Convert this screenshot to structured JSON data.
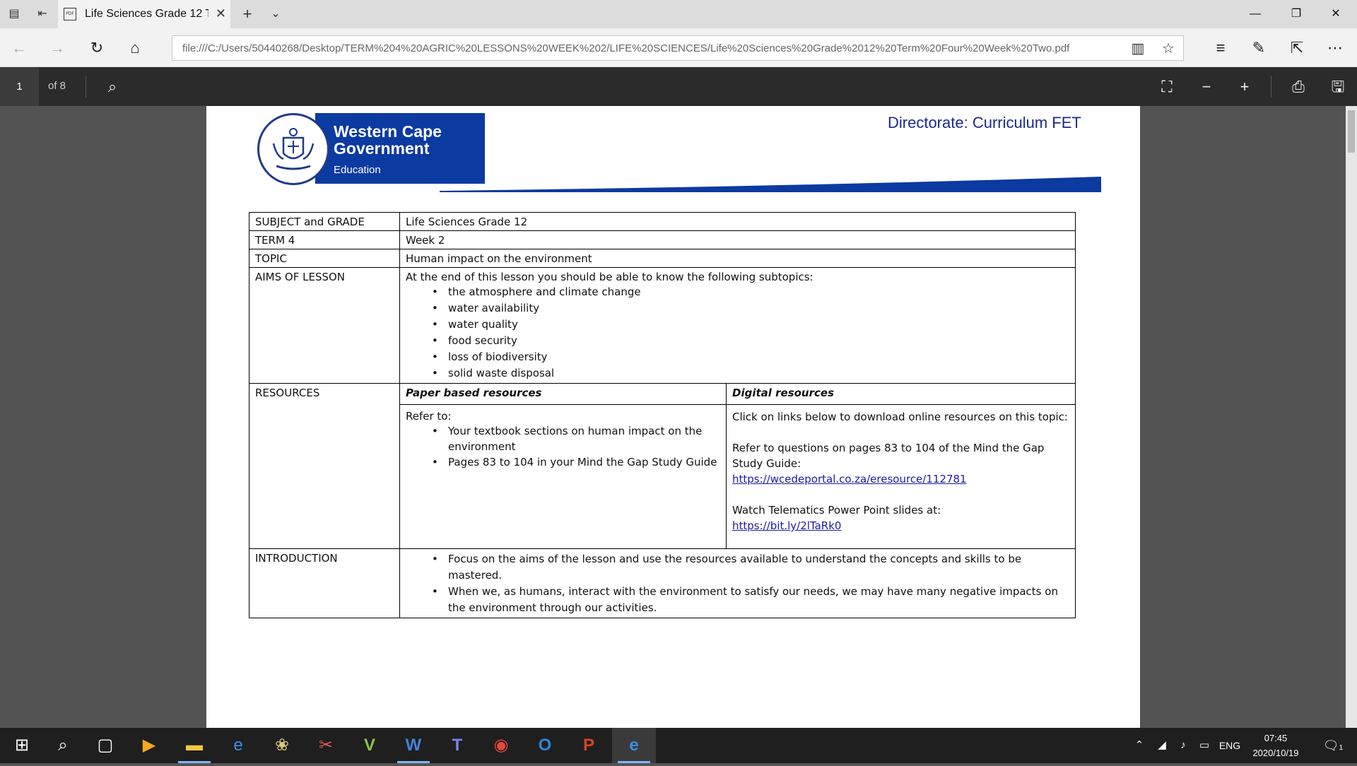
{
  "browser": {
    "tab_title": "Life Sciences Grade 12 T",
    "address": "file:///C:/Users/50440268/Desktop/TERM%204%20AGRIC%20LESSONS%20WEEK%202/LIFE%20SCIENCES/Life%20Sciences%20Grade%2012%20Term%20Four%20Week%20Two.pdf"
  },
  "pdf_toolbar": {
    "current_page": "1",
    "page_total": "of 8"
  },
  "document": {
    "logo": {
      "line1": "Western Cape",
      "line2": "Government",
      "line3": "Education"
    },
    "directorate": "Directorate: Curriculum FET",
    "rows": {
      "subject_label": "SUBJECT and GRADE",
      "subject_value": "Life Sciences Grade 12",
      "term_label": "TERM 4",
      "term_value": "Week 2",
      "topic_label": "TOPIC",
      "topic_value": "Human impact on the environment",
      "aims_label": "AIMS OF LESSON",
      "aims_intro": "At the end of this lesson you should be able to know the following subtopics:",
      "aims_items": [
        "the atmosphere and climate change",
        "water availability",
        "water quality",
        "food security",
        "loss of biodiversity",
        "solid waste disposal"
      ],
      "resources_label": "RESOURCES",
      "paper_heading": "Paper based resources",
      "digital_heading": "Digital resources",
      "paper_intro": "Refer to:",
      "paper_items": [
        "Your textbook sections on human impact on the environment",
        "Pages 83 to 104 in your Mind the Gap Study Guide"
      ],
      "digital_intro": "Click on links below to download online resources on this topic:",
      "digital_refer": "Refer to questions on pages 83 to 104 of the Mind the Gap Study Guide:",
      "digital_link1": "https://wcedeportal.co.za/eresource/112781",
      "digital_watch": "Watch Telematics Power Point slides at:",
      "digital_link2": "https://bit.ly/2lTaRk0",
      "intro_label": "INTRODUCTION",
      "intro_items": [
        "Focus on the aims of the lesson and use the resources available to understand the concepts and skills to be mastered.",
        "When we, as humans, interact with the environment to satisfy our needs, we may have many negative impacts on the environment through our activities."
      ]
    }
  },
  "taskbar": {
    "language": "ENG",
    "time": "07:45",
    "date": "2020/10/19",
    "notifications": "1"
  }
}
